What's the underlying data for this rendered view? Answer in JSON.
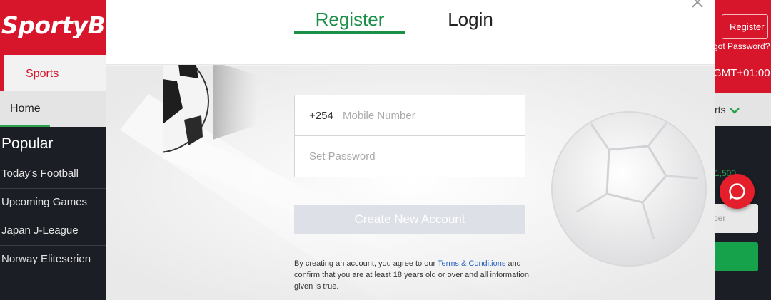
{
  "background_site": {
    "logo": "SportyB",
    "sports_tab": "Sports",
    "home_tab": "Home",
    "popular_title": "Popular",
    "menu": [
      "Today's Football",
      "Upcoming Games",
      "Japan J-League",
      "Norway Eliteserien"
    ],
    "register_button": "Register",
    "forgot_password": "got Password?",
    "timezone": "GMT+01:00",
    "sports_dropdown": "rts",
    "amount": "1,500",
    "number_field": "ber"
  },
  "modal": {
    "tabs": {
      "register": "Register",
      "login": "Login"
    },
    "active_tab": "register",
    "mobile": {
      "prefix": "+254",
      "placeholder": "Mobile Number",
      "value": ""
    },
    "password": {
      "placeholder": "Set Password",
      "value": ""
    },
    "create_button": "Create New Account",
    "terms": {
      "before": "By creating an account, you agree to our ",
      "link": "Terms & Conditions",
      "after": " and confirm that you are at least 18 years old or over and all information given is true."
    }
  },
  "colors": {
    "brand_red": "#d7152b",
    "accent_green": "#1b8e47",
    "link_blue": "#2a63c6",
    "disabled_button": "#dde1e7"
  },
  "icons": [
    "close-icon",
    "chat-icon",
    "chevron-down-icon",
    "soccer-ball-graphic"
  ]
}
